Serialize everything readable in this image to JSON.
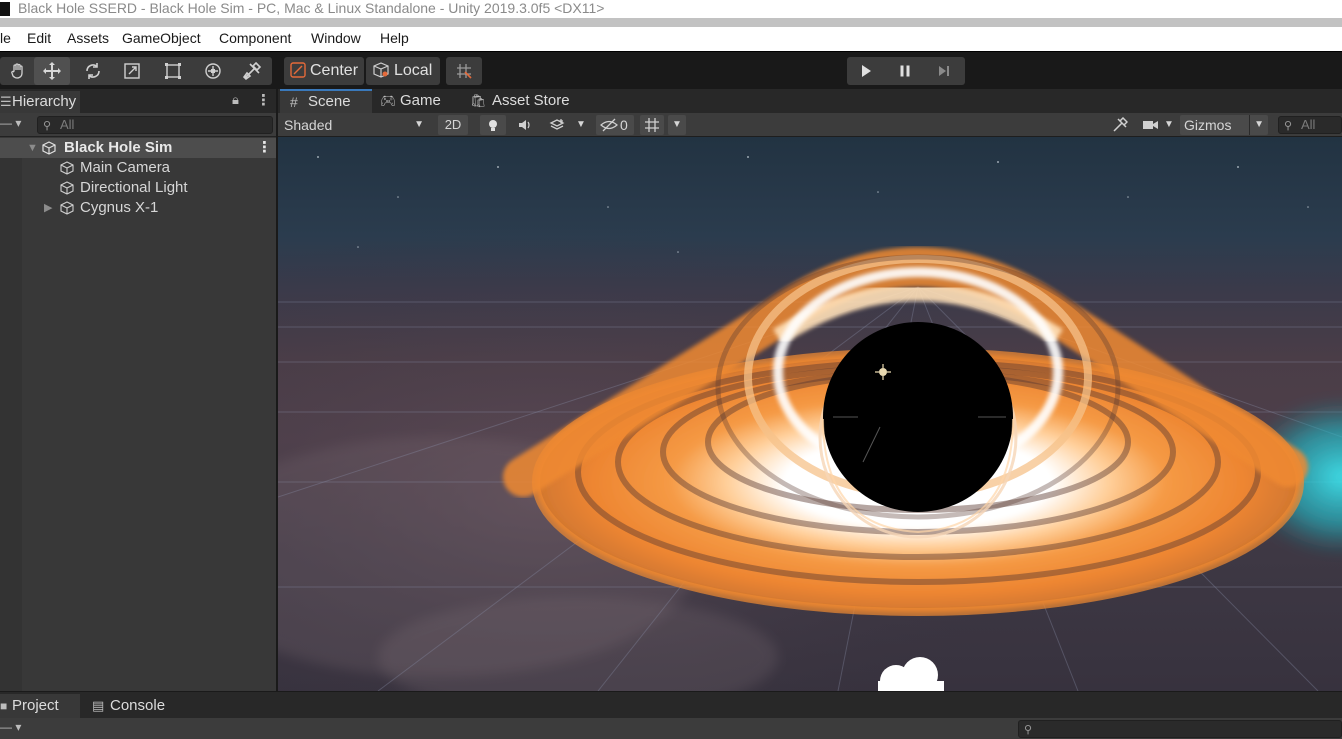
{
  "window": {
    "title": "Black Hole SSERD - Black Hole Sim - PC, Mac & Linux Standalone - Unity 2019.3.0f5 <DX11>"
  },
  "menu": [
    "le",
    "Edit",
    "Assets",
    "GameObject",
    "Component",
    "Window",
    "Help"
  ],
  "toolbar": {
    "pivot_mode": "Center",
    "pivot_rotation": "Local"
  },
  "hierarchy": {
    "tab_label": "Hierarchy",
    "search_placeholder": "All",
    "scene_name": "Black Hole Sim",
    "items": [
      {
        "label": "Main Camera"
      },
      {
        "label": "Directional Light"
      },
      {
        "label": "Cygnus X-1"
      }
    ]
  },
  "scene_view": {
    "tabs": [
      "Scene",
      "Game",
      "Asset Store"
    ],
    "shading_mode": "Shaded",
    "toggle_2d": "2D",
    "hidden_count": "0",
    "gizmos_label": "Gizmos",
    "search_placeholder": "All"
  },
  "bottom_panel": {
    "tabs": [
      "Project",
      "Console"
    ]
  },
  "colors": {
    "accent": "#3a79bb",
    "disk_orange": "#f08a32",
    "pivot_icon": "#e56a3a"
  }
}
